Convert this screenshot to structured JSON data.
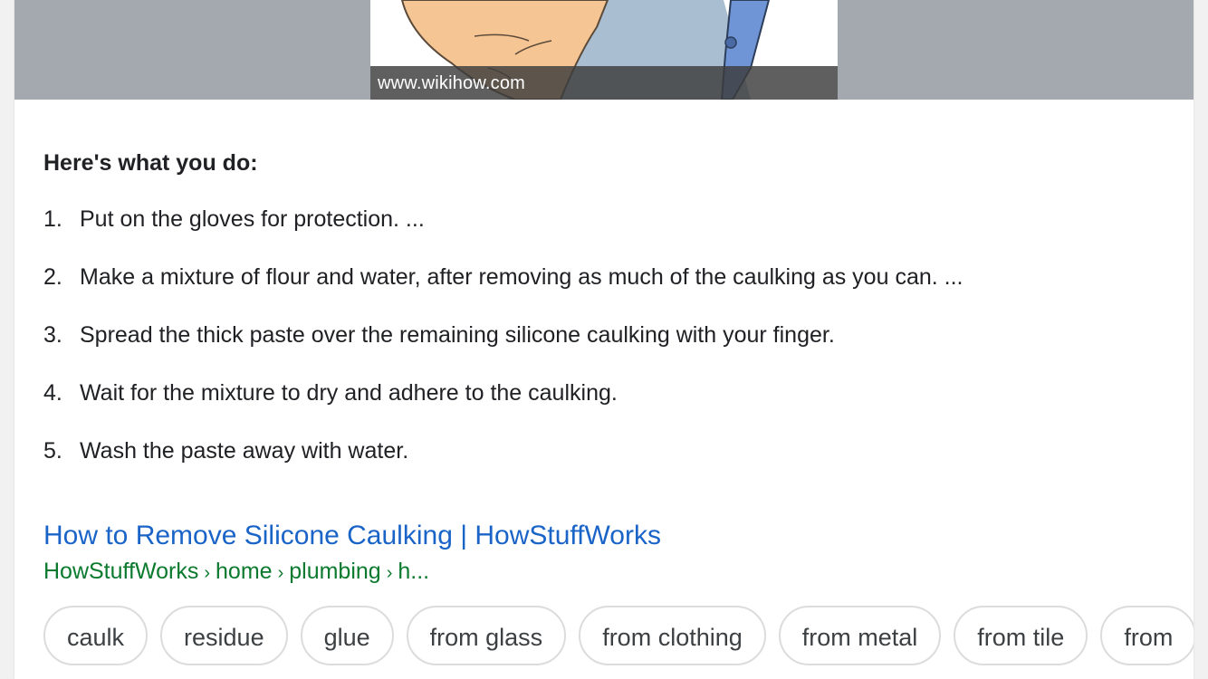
{
  "image": {
    "caption": "www.wikihow.com",
    "colors": {
      "band": "#a3a9ae",
      "skin": "#f5c593",
      "tool": "#9bb6cd",
      "handle": "#6f95d6"
    }
  },
  "answer": {
    "heading": "Here's what you do:",
    "steps": [
      {
        "num": "1.",
        "text": "Put on the gloves for protection. ..."
      },
      {
        "num": "2.",
        "text": "Make a mixture of flour and water, after removing as much of the caulking as you can. ..."
      },
      {
        "num": "3.",
        "text": "Spread the thick paste over the remaining silicone caulking with your finger."
      },
      {
        "num": "4.",
        "text": "Wait for the mixture to dry and adhere to the caulking."
      },
      {
        "num": "5.",
        "text": "Wash the paste away with water."
      }
    ]
  },
  "result": {
    "title": "How to Remove Silicone Caulking | HowStuffWorks",
    "breadcrumb": [
      "HowStuffWorks",
      "home",
      "plumbing",
      "h..."
    ],
    "breadcrumb_separator": "›",
    "title_color": "#1a64c8",
    "breadcrumb_color": "#0b7a2e"
  },
  "chips": [
    "caulk",
    "residue",
    "glue",
    "from glass",
    "from clothing",
    "from metal",
    "from tile",
    "from"
  ]
}
